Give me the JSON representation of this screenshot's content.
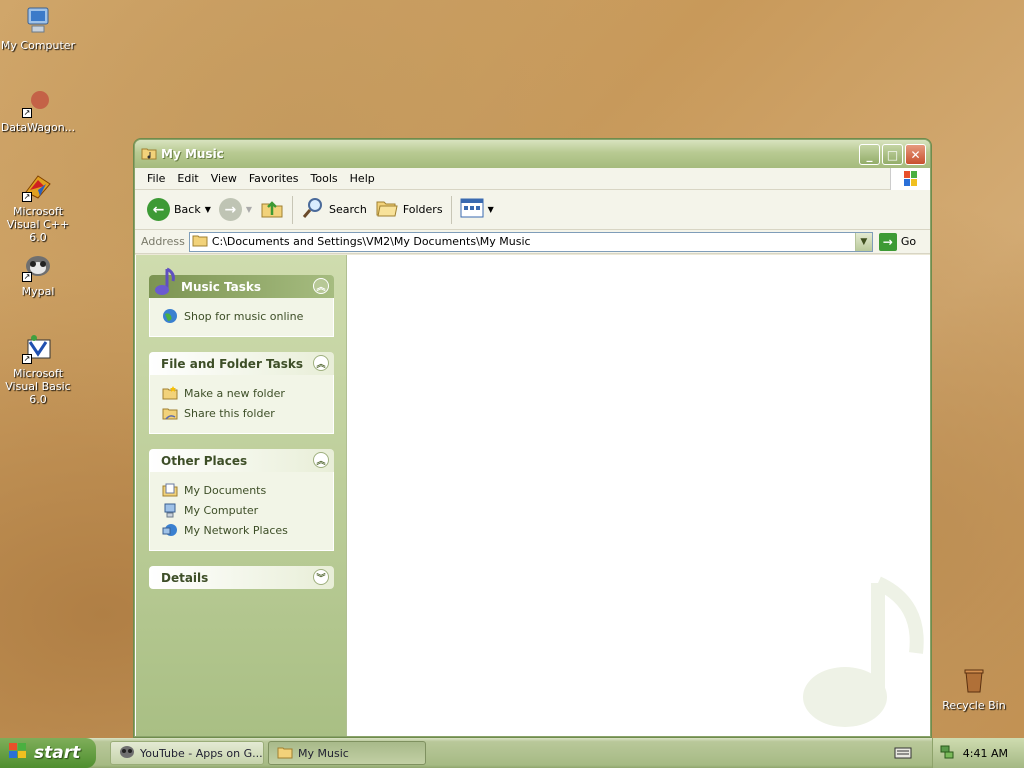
{
  "desktop": {
    "icons": [
      {
        "label": "My Computer"
      },
      {
        "label": "DataWagon..."
      },
      {
        "label": "Microsoft Visual C++ 6.0"
      },
      {
        "label": "Mypal"
      },
      {
        "label": "Microsoft Visual Basic 6.0"
      },
      {
        "label": "Recycle Bin"
      }
    ]
  },
  "window": {
    "title": "My Music",
    "menu": [
      "File",
      "Edit",
      "View",
      "Favorites",
      "Tools",
      "Help"
    ],
    "toolbar": {
      "back": "Back",
      "search": "Search",
      "folders": "Folders"
    },
    "address": {
      "label": "Address",
      "value": "C:\\Documents and Settings\\VM2\\My Documents\\My Music",
      "go": "Go"
    },
    "taskpane": {
      "music_tasks": {
        "title": "Music Tasks",
        "items": [
          "Shop for music online"
        ]
      },
      "file_folder_tasks": {
        "title": "File and Folder Tasks",
        "items": [
          "Make a new folder",
          "Share this folder"
        ]
      },
      "other_places": {
        "title": "Other Places",
        "items": [
          "My Documents",
          "My Computer",
          "My Network Places"
        ]
      },
      "details": {
        "title": "Details"
      }
    }
  },
  "taskbar": {
    "start": "start",
    "tasks": [
      "YouTube - Apps on G...",
      "My Music"
    ],
    "clock": "4:41 AM"
  },
  "colors": {
    "accent": "#a5bb7d",
    "taskpane": "#cfdcae",
    "start": "#4f8f2f"
  }
}
